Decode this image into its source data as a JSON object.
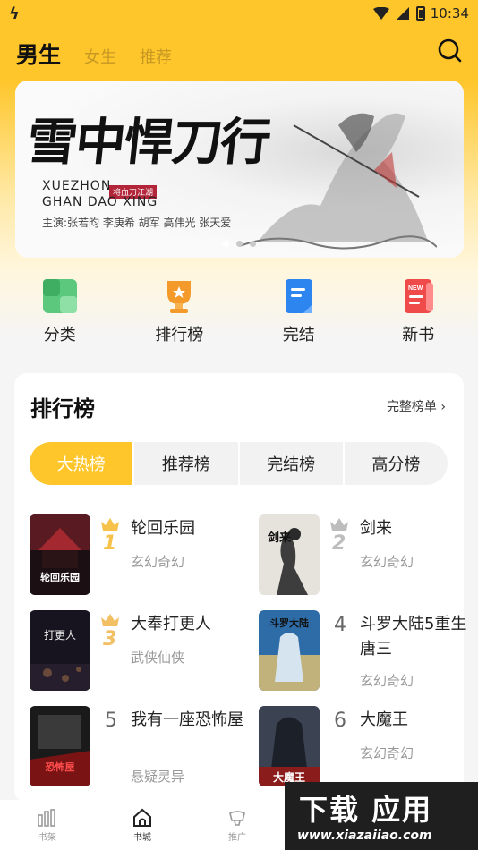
{
  "status": {
    "carrier_icon": "lightning-icon",
    "time": "10:34"
  },
  "header": {
    "tabs": [
      {
        "label": "男生",
        "active": true
      },
      {
        "label": "女生",
        "active": false
      },
      {
        "label": "推荐",
        "active": false
      }
    ]
  },
  "banner": {
    "title": "雪中悍刀行",
    "subtitle_line1": "XUEZHON",
    "subtitle_line2": "GHAN DAO XING",
    "tag": "将血刀江湖",
    "cast": "主演:张若昀  李庚希  胡军  高伟光  张天爱",
    "slide_count": 3,
    "active_slide": 1
  },
  "quick_nav": [
    {
      "label": "分类",
      "icon": "category-icon",
      "color": "#5cc87e"
    },
    {
      "label": "排行榜",
      "icon": "trophy-icon",
      "color": "#f39a2b"
    },
    {
      "label": "完结",
      "icon": "book-done-icon",
      "color": "#2d86f0"
    },
    {
      "label": "新书",
      "icon": "new-book-icon",
      "color": "#f04b4b"
    }
  ],
  "ranking": {
    "title": "排行榜",
    "more_label": "完整榜单 ›",
    "tabs": [
      "大热榜",
      "推荐榜",
      "完结榜",
      "高分榜"
    ],
    "active_tab": 0,
    "books": [
      {
        "rank": "1",
        "name": "轮回乐园",
        "genre": "玄幻奇幻"
      },
      {
        "rank": "2",
        "name": "剑来",
        "genre": "玄幻奇幻"
      },
      {
        "rank": "3",
        "name": "大奉打更人",
        "genre": "武侠仙侠"
      },
      {
        "rank": "4",
        "name": "斗罗大陆5重生唐三",
        "genre": "玄幻奇幻"
      },
      {
        "rank": "5",
        "name": "我有一座恐怖屋",
        "genre": "悬疑灵异"
      },
      {
        "rank": "6",
        "name": "大魔王",
        "genre": "玄幻奇幻"
      }
    ],
    "cover_texts": [
      "轮回乐园",
      "剑来",
      "打更人",
      "斗罗大陆",
      "恐怖屋",
      "大魔王"
    ]
  },
  "bottom_nav": [
    {
      "label": "书架",
      "icon": "bookshelf-icon"
    },
    {
      "label": "书城",
      "icon": "home-icon",
      "active": true
    },
    {
      "label": "推广",
      "icon": "promote-icon"
    }
  ],
  "watermark": {
    "line1": "下载 应用",
    "line2": "www.xiazaiiao.com"
  },
  "colors": {
    "accent": "#ffc62b",
    "gold": "#f6c24a",
    "silver": "#bdbdbd",
    "bronze": "#f2c063"
  }
}
